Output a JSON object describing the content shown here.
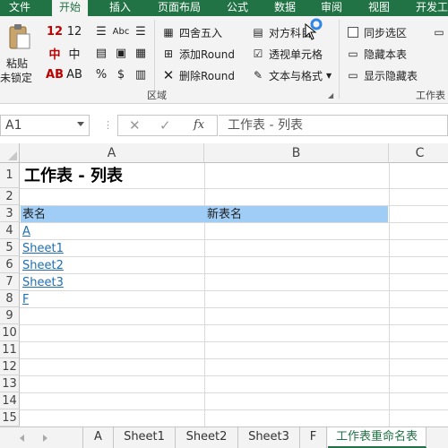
{
  "ribbon": {
    "tabs": [
      "文件",
      "开始",
      "插入",
      "页面布局",
      "公式",
      "数据",
      "审阅",
      "视图",
      "开发工"
    ],
    "paste_label_1": "粘贴",
    "paste_label_2": "未锁定",
    "font_glyphs": [
      "12",
      "中",
      "AB",
      "A",
      "%",
      "$"
    ],
    "abc_label": "Abc",
    "buttons": {
      "round": "四舍五入",
      "add_round": "添加Round",
      "delete_round": "删除Round",
      "dui_fang": "对方科目",
      "transparent_cell": "透视单元格",
      "text_format": "文本与格式",
      "sync_select": "同步选区",
      "hide_sheet": "隐藏本表",
      "show_hidden": "显示隐藏表"
    },
    "groups": {
      "region": "区域",
      "worksheet": "工作表"
    }
  },
  "formula_bar": {
    "name_box": "A1",
    "cancel_icon": "close-icon",
    "enter_icon": "check-icon",
    "fx": "fx",
    "formula": "工作表 - 列表"
  },
  "grid": {
    "columns": [
      "A",
      "B",
      "C"
    ],
    "rows": [
      "1",
      "2",
      "3",
      "4",
      "5",
      "6",
      "7",
      "8",
      "9",
      "10",
      "11",
      "12",
      "13",
      "14",
      "15"
    ],
    "title": "工作表 - 列表",
    "header_a": "表名",
    "header_b": "新表名",
    "sheet_links": [
      "A",
      "Sheet1",
      "Sheet2",
      "Sheet3",
      "F"
    ],
    "colors": {
      "header_band": "#9fcdf5",
      "link": "#1f6fb2",
      "accent": "#217346"
    }
  },
  "sheet_tabs": {
    "tabs": [
      "A",
      "Sheet1",
      "Sheet2",
      "Sheet3",
      "F",
      "工作表重命名表"
    ],
    "active_index": 5
  }
}
